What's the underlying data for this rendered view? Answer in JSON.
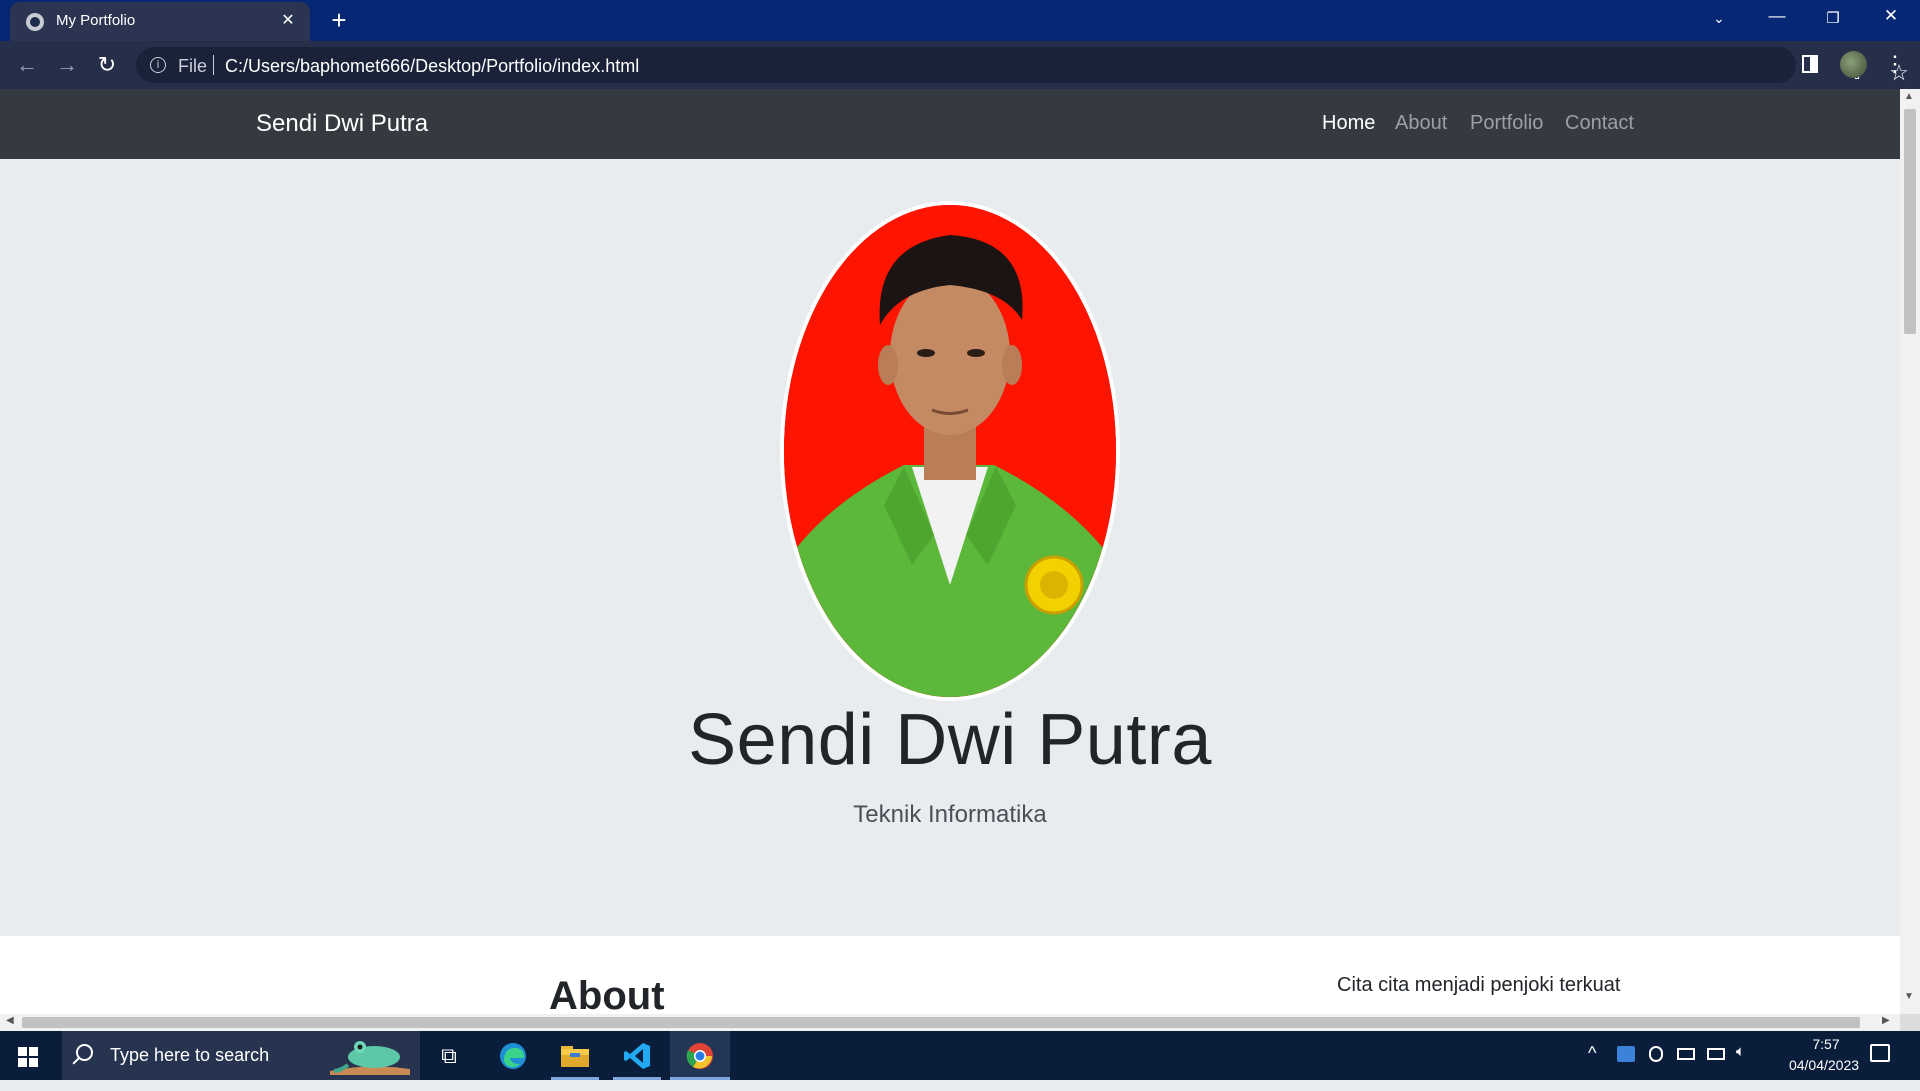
{
  "browser": {
    "tab_title": "My Portfolio",
    "tab_close": "✕",
    "new_tab": "+",
    "file_label": "File",
    "url": "C:/Users/baphomet666/Desktop/Portfolio/index.html"
  },
  "navbar": {
    "brand": "Sendi Dwi Putra",
    "links": [
      "Home",
      "About",
      "Portfolio",
      "Contact"
    ],
    "active": "Home"
  },
  "hero": {
    "name": "Sendi Dwi Putra",
    "subtitle": "Teknik Informatika"
  },
  "about": {
    "heading": "About",
    "text": "Cita cita menjadi penjoki terkuat"
  },
  "taskbar": {
    "search_placeholder": "Type here to search",
    "time": "7:57",
    "date": "04/04/2023"
  },
  "icons": {
    "search": "search-icon",
    "start": "windows-start-icon",
    "edge": "edge-icon",
    "explorer": "file-explorer-icon",
    "vscode": "vscode-icon",
    "chrome": "chrome-icon"
  },
  "colors": {
    "titlebar": "#062774",
    "navbar": "#343a40",
    "jumbotron": "#e9ecef",
    "photo_bg": "#fd1401"
  }
}
